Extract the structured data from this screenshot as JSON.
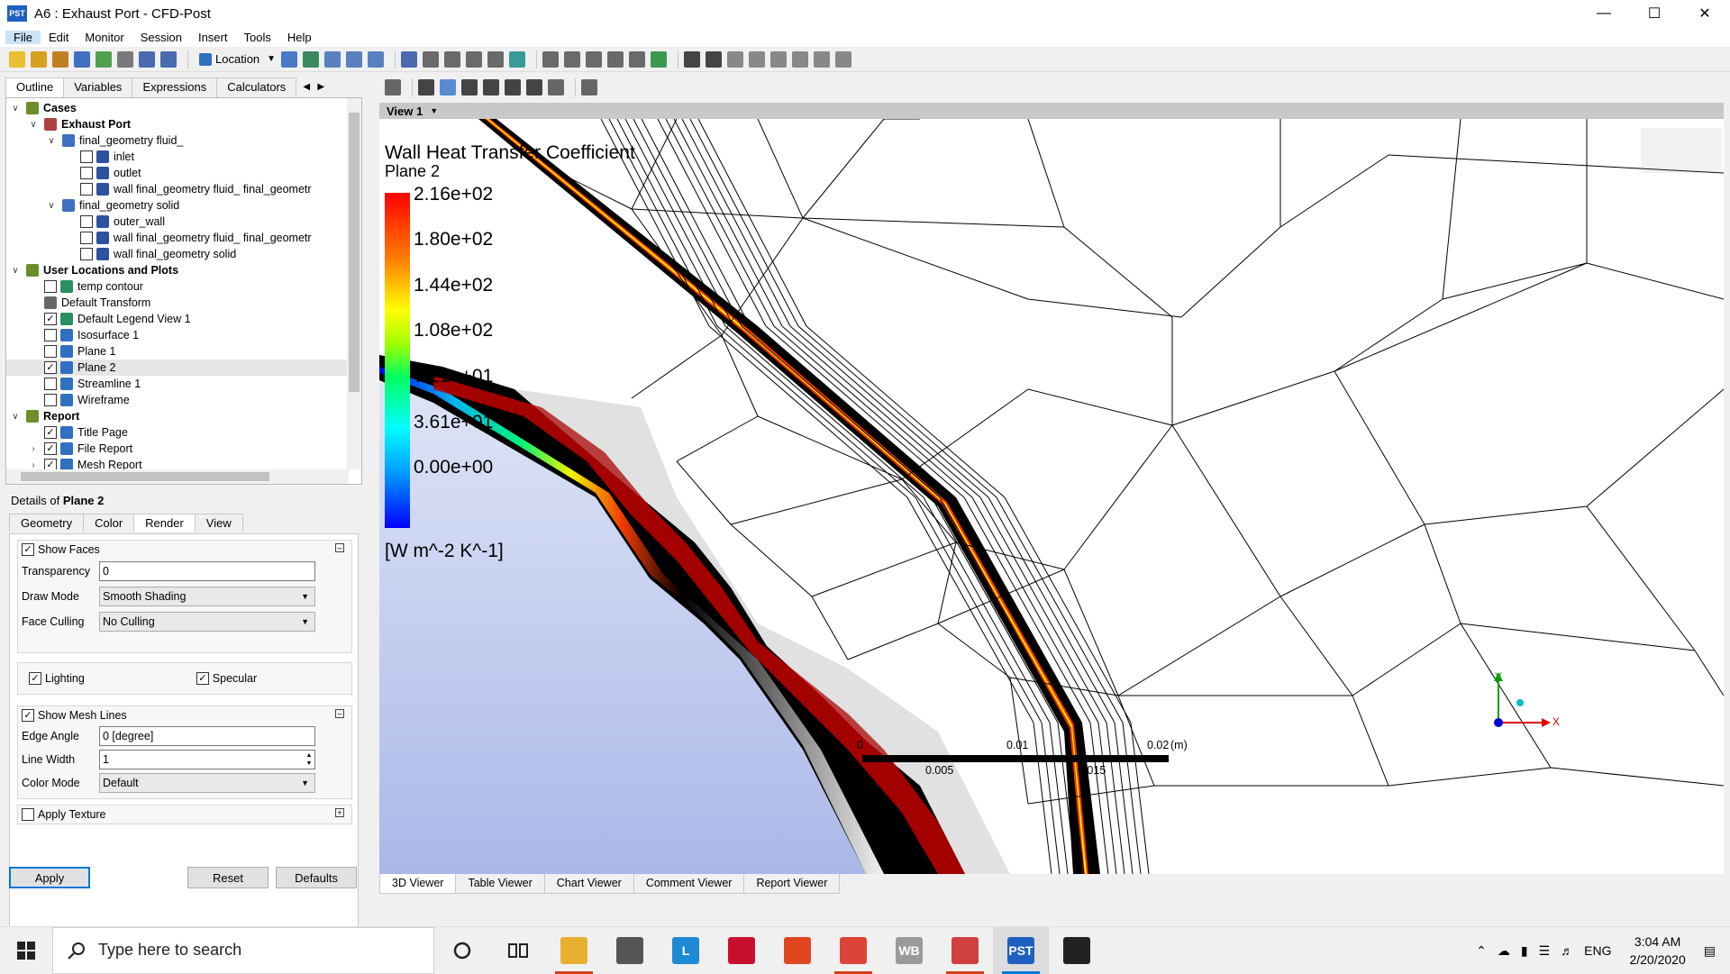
{
  "window": {
    "title": "A6 : Exhaust Port - CFD-Post",
    "app_badge": "PST"
  },
  "menu": [
    "File",
    "Edit",
    "Monitor",
    "Session",
    "Insert",
    "Tools",
    "Help"
  ],
  "toolbar": {
    "location_label": "Location"
  },
  "left_tabs": [
    "Outline",
    "Variables",
    "Expressions",
    "Calculators"
  ],
  "tree": [
    {
      "label": "Cases",
      "level": 0,
      "bold": true,
      "expander": "v",
      "checkbox": null,
      "icon": "cases-icon",
      "color": "#6a8f2a"
    },
    {
      "label": "Exhaust Port",
      "level": 1,
      "bold": true,
      "expander": "v",
      "checkbox": null,
      "icon": "case-icon",
      "color": "#b04040"
    },
    {
      "label": "final_geometry fluid_",
      "level": 2,
      "bold": false,
      "expander": "v",
      "checkbox": null,
      "icon": "domain-icon",
      "color": "#4070c0"
    },
    {
      "label": "inlet",
      "level": 3,
      "bold": false,
      "expander": "",
      "checkbox": false,
      "icon": "boundary-icon",
      "color": "#3050a0"
    },
    {
      "label": "outlet",
      "level": 3,
      "bold": false,
      "expander": "",
      "checkbox": false,
      "icon": "boundary-icon",
      "color": "#3050a0"
    },
    {
      "label": "wall final_geometry fluid_ final_geometr",
      "level": 3,
      "bold": false,
      "expander": "",
      "checkbox": false,
      "icon": "boundary-icon",
      "color": "#3050a0"
    },
    {
      "label": "final_geometry solid",
      "level": 2,
      "bold": false,
      "expander": "v",
      "checkbox": null,
      "icon": "domain-icon",
      "color": "#4070c0"
    },
    {
      "label": "outer_wall",
      "level": 3,
      "bold": false,
      "expander": "",
      "checkbox": false,
      "icon": "boundary-icon",
      "color": "#3050a0"
    },
    {
      "label": "wall final_geometry fluid_ final_geometr",
      "level": 3,
      "bold": false,
      "expander": "",
      "checkbox": false,
      "icon": "boundary-icon",
      "color": "#3050a0"
    },
    {
      "label": "wall final_geometry solid",
      "level": 3,
      "bold": false,
      "expander": "",
      "checkbox": false,
      "icon": "boundary-icon",
      "color": "#3050a0"
    },
    {
      "label": "User Locations and Plots",
      "level": 0,
      "bold": true,
      "expander": "v",
      "checkbox": null,
      "icon": "user-locations-icon",
      "color": "#6a8f2a"
    },
    {
      "label": "temp contour",
      "level": 1,
      "bold": false,
      "expander": "",
      "checkbox": false,
      "icon": "contour-icon",
      "color": "#2a8f60"
    },
    {
      "label": "Default Transform",
      "level": 1,
      "bold": false,
      "expander": "",
      "checkbox": null,
      "icon": "transform-icon",
      "color": "#666666"
    },
    {
      "label": "Default Legend View 1",
      "level": 1,
      "bold": false,
      "expander": "",
      "checkbox": true,
      "icon": "legend-icon",
      "color": "#2a8f60"
    },
    {
      "label": "Isosurface 1",
      "level": 1,
      "bold": false,
      "expander": "",
      "checkbox": false,
      "icon": "isosurface-icon",
      "color": "#3070c0"
    },
    {
      "label": "Plane 1",
      "level": 1,
      "bold": false,
      "expander": "",
      "checkbox": false,
      "icon": "plane-icon",
      "color": "#3070c0"
    },
    {
      "label": "Plane 2",
      "level": 1,
      "bold": false,
      "expander": "",
      "checkbox": true,
      "icon": "plane-icon",
      "color": "#3070c0",
      "selected": true
    },
    {
      "label": "Streamline 1",
      "level": 1,
      "bold": false,
      "expander": "",
      "checkbox": false,
      "icon": "streamline-icon",
      "color": "#3070c0"
    },
    {
      "label": "Wireframe",
      "level": 1,
      "bold": false,
      "expander": "",
      "checkbox": false,
      "icon": "wireframe-icon",
      "color": "#3070c0"
    },
    {
      "label": "Report",
      "level": 0,
      "bold": true,
      "expander": "v",
      "checkbox": null,
      "icon": "report-icon",
      "color": "#6a8f2a"
    },
    {
      "label": "Title Page",
      "level": 1,
      "bold": false,
      "expander": "",
      "checkbox": true,
      "icon": "page-icon",
      "color": "#3070c0"
    },
    {
      "label": "File Report",
      "level": 1,
      "bold": false,
      "expander": ">",
      "checkbox": true,
      "icon": "page-icon",
      "color": "#3070c0"
    },
    {
      "label": "Mesh Report",
      "level": 1,
      "bold": false,
      "expander": ">",
      "checkbox": true,
      "icon": "page-icon",
      "color": "#3070c0"
    }
  ],
  "details": {
    "title_prefix": "Details of ",
    "title_obj": "Plane 2",
    "tabs": [
      "Geometry",
      "Color",
      "Render",
      "View"
    ],
    "show_faces": "Show Faces",
    "transparency_label": "Transparency",
    "transparency_value": "0",
    "draw_mode_label": "Draw Mode",
    "draw_mode_value": "Smooth Shading",
    "face_culling_label": "Face Culling",
    "face_culling_value": "No Culling",
    "lighting": "Lighting",
    "specular": "Specular",
    "show_mesh_lines": "Show Mesh Lines",
    "edge_angle_label": "Edge Angle",
    "edge_angle_value": "0 [degree]",
    "line_width_label": "Line Width",
    "line_width_value": "1",
    "color_mode_label": "Color Mode",
    "color_mode_value": "Default",
    "apply_texture": "Apply Texture",
    "apply_btn": "Apply",
    "reset_btn": "Reset",
    "defaults_btn": "Defaults"
  },
  "viewer": {
    "view_name": "View 1",
    "legend_title": "Wall Heat Transfer Coefficient",
    "legend_subtitle": "Plane 2",
    "legend_labels": [
      "2.16e+02",
      "1.80e+02",
      "1.44e+02",
      "1.08e+02",
      "7.21e+01",
      "3.61e+01",
      "0.00e+00"
    ],
    "legend_units": "[W m^-2 K^-1]",
    "scale_top": [
      "0",
      "0.01",
      "0.02",
      "(m)"
    ],
    "scale_bottom": [
      "0.005",
      "0.015"
    ],
    "axis_y": "Y",
    "axis_x": "X",
    "bottom_tabs": [
      "3D Viewer",
      "Table Viewer",
      "Chart Viewer",
      "Comment Viewer",
      "Report Viewer"
    ]
  },
  "taskbar": {
    "search_placeholder": "Type here to search",
    "lang": "ENG",
    "time": "3:04 AM",
    "date": "2/20/2020",
    "apps": [
      {
        "name": "file-explorer-icon",
        "label": "",
        "color": "#e8b030"
      },
      {
        "name": "mail-icon",
        "label": "",
        "color": "#555555"
      },
      {
        "name": "l-app-icon",
        "label": "L",
        "color": "#1e8ad6"
      },
      {
        "name": "mcafee-icon",
        "label": "",
        "color": "#c8102e"
      },
      {
        "name": "office-icon",
        "label": "",
        "color": "#e2461f"
      },
      {
        "name": "chrome-icon",
        "label": "",
        "color": "#db4437"
      },
      {
        "name": "workbench-icon",
        "label": "WB",
        "color": "#9a9a9a"
      },
      {
        "name": "fan-app-icon",
        "label": "",
        "color": "#d04040"
      },
      {
        "name": "cfd-post-icon",
        "label": "PST",
        "color": "#1f5fbf"
      },
      {
        "name": "photos-icon",
        "label": "",
        "color": "#222222"
      }
    ]
  }
}
